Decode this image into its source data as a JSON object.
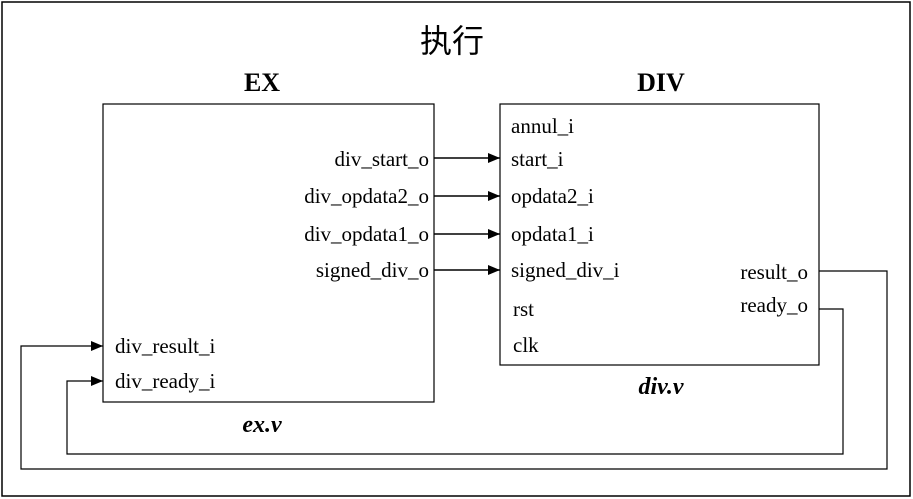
{
  "title": "执行",
  "ex": {
    "name": "EX",
    "file": "ex.v",
    "outputs": [
      "div_start_o",
      "div_opdata2_o",
      "div_opdata1_o",
      "signed_div_o"
    ],
    "inputs": [
      "div_result_i",
      "div_ready_i"
    ]
  },
  "div": {
    "name": "DIV",
    "file": "div.v",
    "inputs": [
      "annul_i",
      "start_i",
      "opdata2_i",
      "opdata1_i",
      "signed_div_i",
      "rst",
      "clk"
    ],
    "outputs": [
      "result_o",
      "ready_o"
    ]
  },
  "colors": {
    "line": "#000000",
    "background": "#ffffff"
  }
}
